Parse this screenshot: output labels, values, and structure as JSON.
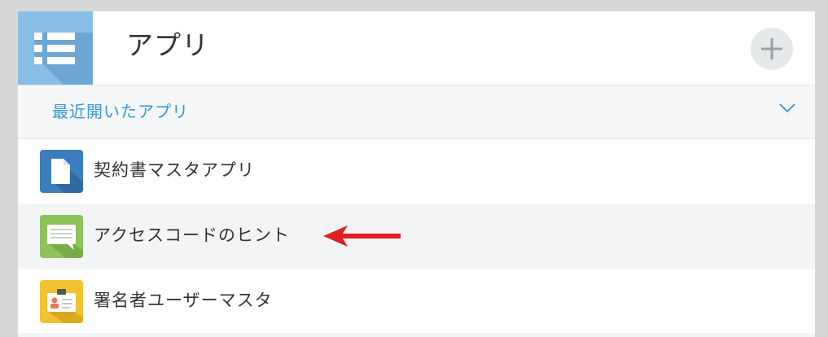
{
  "header": {
    "title": "アプリ",
    "icon": "app-list-icon",
    "add_icon": "plus-icon"
  },
  "recent": {
    "label": "最近開いたアプリ",
    "toggle_icon": "chevron-down-icon"
  },
  "apps": [
    {
      "label": "契約書マスタアプリ",
      "icon": "document-icon",
      "color": "#3b7dbd"
    },
    {
      "label": "アクセスコードのヒント",
      "icon": "speech-bubble-icon",
      "color": "#8ec25a"
    },
    {
      "label": "署名者ユーザーマスタ",
      "icon": "id-badge-icon",
      "color": "#f1c232"
    }
  ],
  "annotation": {
    "icon": "red-arrow-icon",
    "color": "#e02020"
  },
  "colors": {
    "accent": "#3498db",
    "header_icon_bg": "#88bde6",
    "page_bg": "#d6d8d9"
  }
}
